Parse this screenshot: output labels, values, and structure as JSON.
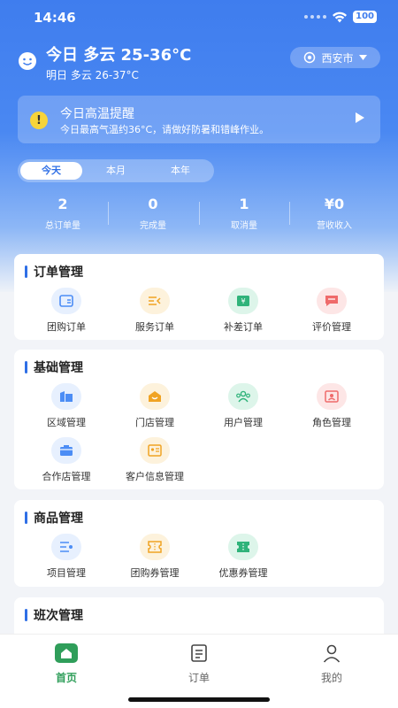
{
  "status_bar": {
    "time": "14:46",
    "battery": "100"
  },
  "weather": {
    "today": "今日 多云 25-36°C",
    "tomorrow": "明日 多云 26-37°C",
    "city": "西安市"
  },
  "alert": {
    "title": "今日高温提醒",
    "desc": "今日最高气温约36°C，请做好防暑和错峰作业。"
  },
  "period_tabs": [
    {
      "label": "今天",
      "active": true
    },
    {
      "label": "本月",
      "active": false
    },
    {
      "label": "本年",
      "active": false
    }
  ],
  "stats": [
    {
      "value": "2",
      "label": "总订单量"
    },
    {
      "value": "0",
      "label": "完成量"
    },
    {
      "value": "1",
      "label": "取消量"
    },
    {
      "value": "¥0",
      "label": "营收收入"
    }
  ],
  "sections": {
    "orders": {
      "title": "订单管理",
      "items": [
        {
          "label": "团购订单",
          "icon": "group-order-icon",
          "color": "#4c8df5",
          "bg": "#e7f0fe"
        },
        {
          "label": "服务订单",
          "icon": "service-order-icon",
          "color": "#f0a323",
          "bg": "#fdf2dc"
        },
        {
          "label": "补差订单",
          "icon": "supplement-order-icon",
          "color": "#2fb37a",
          "bg": "#ddf5ea"
        },
        {
          "label": "评价管理",
          "icon": "review-icon",
          "color": "#ef6a6a",
          "bg": "#fde6e6"
        }
      ]
    },
    "basic": {
      "title": "基础管理",
      "items": [
        {
          "label": "区域管理",
          "icon": "region-icon",
          "color": "#4c8df5",
          "bg": "#e7f0fe"
        },
        {
          "label": "门店管理",
          "icon": "store-icon",
          "color": "#f0a323",
          "bg": "#fdf2dc"
        },
        {
          "label": "用户管理",
          "icon": "users-icon",
          "color": "#2fb37a",
          "bg": "#ddf5ea"
        },
        {
          "label": "角色管理",
          "icon": "role-icon",
          "color": "#ef6a6a",
          "bg": "#fde6e6"
        },
        {
          "label": "合作店管理",
          "icon": "partner-store-icon",
          "color": "#4c8df5",
          "bg": "#e7f0fe"
        },
        {
          "label": "客户信息管理",
          "icon": "customer-info-icon",
          "color": "#f0a323",
          "bg": "#fdf2dc"
        }
      ]
    },
    "goods": {
      "title": "商品管理",
      "items": [
        {
          "label": "项目管理",
          "icon": "project-icon",
          "color": "#4c8df5",
          "bg": "#e7f0fe"
        },
        {
          "label": "团购券管理",
          "icon": "group-coupon-icon",
          "color": "#f0a323",
          "bg": "#fdf2dc"
        },
        {
          "label": "优惠券管理",
          "icon": "coupon-icon",
          "color": "#2fb37a",
          "bg": "#ddf5ea"
        }
      ]
    },
    "shifts": {
      "title": "班次管理"
    }
  },
  "bottom_nav": [
    {
      "label": "首页",
      "active": true
    },
    {
      "label": "订单",
      "active": false
    },
    {
      "label": "我的",
      "active": false
    }
  ]
}
